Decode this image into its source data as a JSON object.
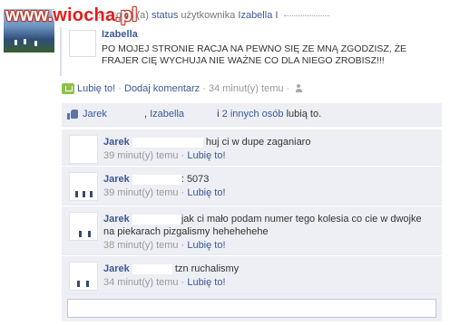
{
  "watermark": {
    "prefix": "www.",
    "brand": "wiocha",
    "suffix": ".pl"
  },
  "story": {
    "header_part1": "s",
    "header_verb": "entował(a)",
    "header_status_link": "status",
    "header_owner_text": "użytkownika",
    "header_target_link": "Izabella I"
  },
  "post": {
    "author": "Izabella",
    "text": "PO MOJEJ STRONIE RACJA NA PEWNO SIĘ ZE MNĄ ZGODZISZ, ŻE FRAJER CIĘ WYCHUJA NIE WAŻNE CO DLA NIEGO ZROBISZ!!!"
  },
  "actions": {
    "like": "Lubię to!",
    "sep1": "·",
    "comment": "Dodaj komentarz",
    "sep2": "·",
    "time": "34 minut(y) temu",
    "sep3": "·"
  },
  "likes": {
    "person1": "Jarek",
    "comma": ",",
    "person2": "Izabella",
    "and": "i",
    "others": "2 innych osób",
    "suffix": "lubią to."
  },
  "comments": [
    {
      "author": "Jarek",
      "text": "huj ci w dupe zaganiaro",
      "time": "39 minut(y) temu",
      "sep": "·",
      "like": "Lubię to!"
    },
    {
      "author": "Jarek",
      "text": ": 5073",
      "time": "39 minut(y) temu",
      "sep": "·",
      "like": "Lubię to!"
    },
    {
      "author": "Jarek",
      "text": "jak ci mało podam numer tego kolesia co cie w dwojke na piekarach pizgalismy hehehehehe",
      "time": "38 minut(y) temu",
      "sep": "·",
      "like": "Lubię to!"
    },
    {
      "author": "Jarek",
      "text": "tzn ruchalismy",
      "time": "34 minut(y) temu",
      "sep": "·",
      "like": "Lubię to!"
    }
  ],
  "reply": {
    "placeholder": "",
    "value": ""
  }
}
